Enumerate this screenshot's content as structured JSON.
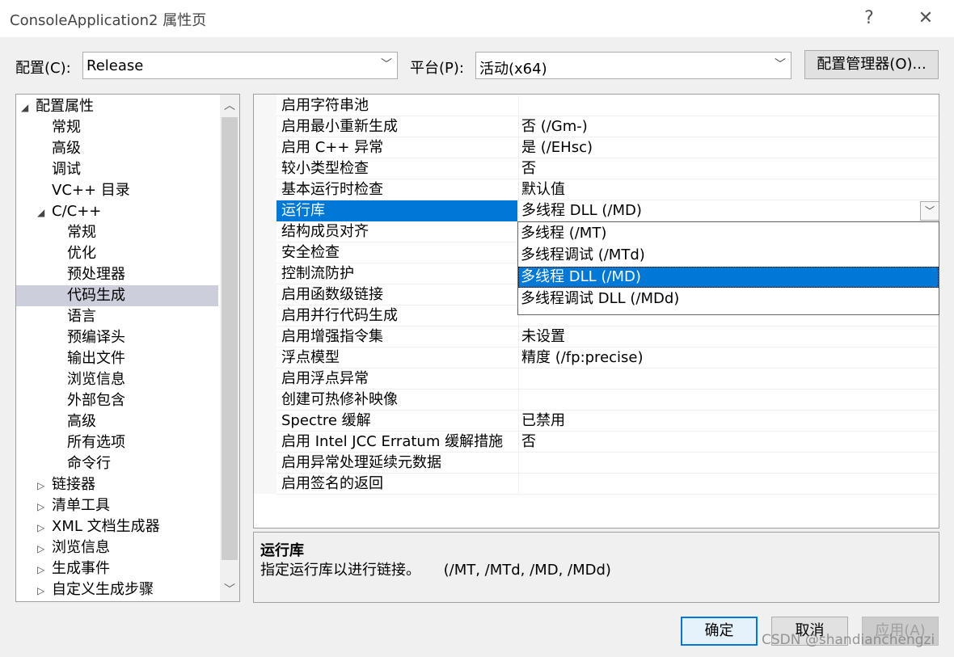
{
  "window": {
    "title": "ConsoleApplication2 属性页",
    "help": "?",
    "close": "✕"
  },
  "config": {
    "config_label": "配置(C):",
    "config_value": "Release",
    "platform_label": "平台(P):",
    "platform_value": "活动(x64)",
    "manager_button": "配置管理器(O)..."
  },
  "tree": {
    "items": [
      {
        "label": "配置属性",
        "twisty": "◢"
      },
      {
        "label": "常规"
      },
      {
        "label": "高级"
      },
      {
        "label": "调试"
      },
      {
        "label": "VC++ 目录"
      },
      {
        "label": "C/C++",
        "twisty": "◢"
      },
      {
        "label": "常规"
      },
      {
        "label": "优化"
      },
      {
        "label": "预处理器"
      },
      {
        "label": "代码生成"
      },
      {
        "label": "语言"
      },
      {
        "label": "预编译头"
      },
      {
        "label": "输出文件"
      },
      {
        "label": "浏览信息"
      },
      {
        "label": "外部包含"
      },
      {
        "label": "高级"
      },
      {
        "label": "所有选项"
      },
      {
        "label": "命令行"
      },
      {
        "label": "链接器",
        "twisty": "▷"
      },
      {
        "label": "清单工具",
        "twisty": "▷"
      },
      {
        "label": "XML 文档生成器",
        "twisty": "▷"
      },
      {
        "label": "浏览信息",
        "twisty": "▷"
      },
      {
        "label": "生成事件",
        "twisty": "▷"
      },
      {
        "label": "自定义生成步骤",
        "twisty": "▷"
      }
    ]
  },
  "grid": {
    "rows": [
      {
        "name": "启用字符串池",
        "value": ""
      },
      {
        "name": "启用最小重新生成",
        "value": "否 (/Gm-)"
      },
      {
        "name": "启用 C++ 异常",
        "value": "是 (/EHsc)"
      },
      {
        "name": "较小类型检查",
        "value": "否"
      },
      {
        "name": "基本运行时检查",
        "value": "默认值"
      },
      {
        "name": "运行库",
        "value": "多线程 DLL (/MD)"
      },
      {
        "name": "结构成员对齐",
        "value": ""
      },
      {
        "name": "安全检查",
        "value": ""
      },
      {
        "name": "控制流防护",
        "value": ""
      },
      {
        "name": "启用函数级链接",
        "value": ""
      },
      {
        "name": "启用并行代码生成",
        "value": ""
      },
      {
        "name": "启用增强指令集",
        "value": "未设置"
      },
      {
        "name": "浮点模型",
        "value": "精度 (/fp:precise)"
      },
      {
        "name": "启用浮点异常",
        "value": ""
      },
      {
        "name": "创建可热修补映像",
        "value": ""
      },
      {
        "name": "Spectre 缓解",
        "value": "已禁用"
      },
      {
        "name": "启用 Intel JCC Erratum 缓解措施",
        "value": "否"
      },
      {
        "name": "启用异常处理延续元数据",
        "value": ""
      },
      {
        "name": "启用签名的返回",
        "value": ""
      }
    ]
  },
  "dropdown": {
    "options": [
      "多线程 (/MT)",
      "多线程调试 (/MTd)",
      "多线程 DLL (/MD)",
      "多线程调试 DLL (/MDd)"
    ]
  },
  "description": {
    "title": "运行库",
    "text": "指定运行库以进行链接。     (/MT, /MTd, /MD, /MDd)"
  },
  "buttons": {
    "ok": "确定",
    "cancel": "取消",
    "apply": "应用(A)"
  },
  "watermark": "CSDN @shandianchengzi",
  "colors": {
    "accent": "#0078d7",
    "tree_selection": "#cccedb"
  }
}
